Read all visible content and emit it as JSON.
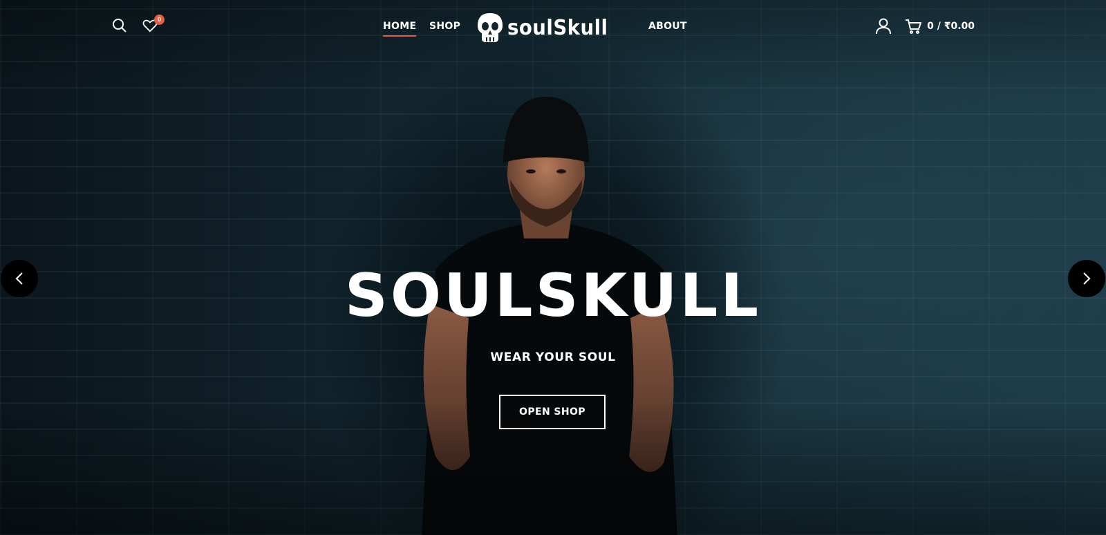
{
  "header": {
    "search_icon": "search-icon",
    "wishlist_icon": "heart-icon",
    "wishlist_count": "0",
    "nav": [
      {
        "label": "HOME",
        "active": true
      },
      {
        "label": "SHOP",
        "active": false
      },
      {
        "label": "ABOUT",
        "active": false
      }
    ],
    "logo_text": "soulSkull",
    "account_icon": "user-icon",
    "cart_icon": "cart-icon",
    "cart_summary": "0 / ₹0.00"
  },
  "hero": {
    "title": "SOULSKULL",
    "subtitle": "WEAR YOUR SOUL",
    "cta_label": "OPEN SHOP",
    "prev_icon": "chevron-left-icon",
    "next_icon": "chevron-right-icon"
  },
  "colors": {
    "accent": "#e2603f",
    "text": "#ffffff",
    "background": "#12242d"
  }
}
